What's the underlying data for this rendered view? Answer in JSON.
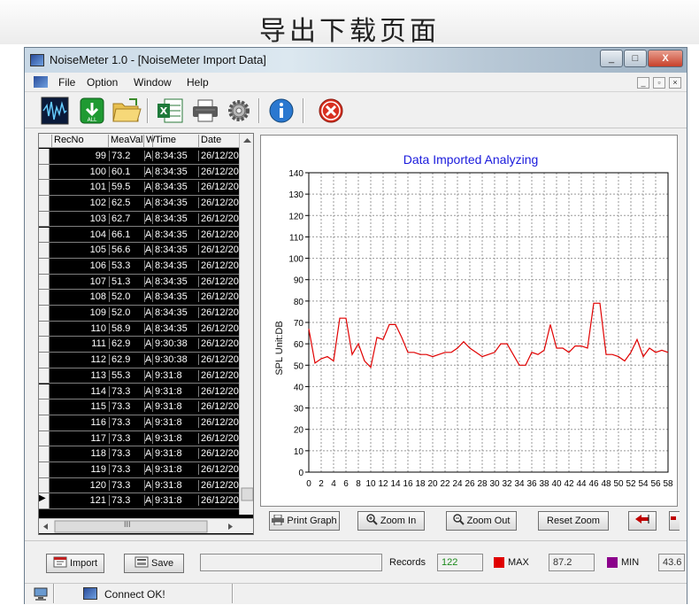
{
  "page": {
    "title": "导出下载页面"
  },
  "window": {
    "caption": "NoiseMeter 1.0  - [NoiseMeter Import Data]",
    "buttons": {
      "minimize": "_",
      "maximize": "□",
      "close": "X"
    }
  },
  "menu": {
    "items": [
      "File",
      "Option",
      "Window",
      "Help"
    ],
    "mdi_buttons": [
      "_",
      "▫",
      "×"
    ]
  },
  "toolbar": {
    "icons": [
      "waveform-icon",
      "download-all-icon",
      "open-folder-icon",
      "excel-icon",
      "printer-icon",
      "gear-icon",
      "info-icon",
      "close-icon"
    ]
  },
  "table": {
    "headers": [
      "RecNo",
      "MeaVal",
      "W",
      "Time",
      "Date"
    ],
    "rows": [
      [
        "99",
        "73.2",
        "A",
        "8:34:35",
        "26/12/20"
      ],
      [
        "100",
        "60.1",
        "A",
        "8:34:35",
        "26/12/20"
      ],
      [
        "101",
        "59.5",
        "A",
        "8:34:35",
        "26/12/20"
      ],
      [
        "102",
        "62.5",
        "A",
        "8:34:35",
        "26/12/20"
      ],
      [
        "103",
        "62.7",
        "A",
        "8:34:35",
        "26/12/20"
      ],
      [
        "104",
        "66.1",
        "A",
        "8:34:35",
        "26/12/20"
      ],
      [
        "105",
        "56.6",
        "A",
        "8:34:35",
        "26/12/20"
      ],
      [
        "106",
        "53.3",
        "A",
        "8:34:35",
        "26/12/20"
      ],
      [
        "107",
        "51.3",
        "A",
        "8:34:35",
        "26/12/20"
      ],
      [
        "108",
        "52.0",
        "A",
        "8:34:35",
        "26/12/20"
      ],
      [
        "109",
        "52.0",
        "A",
        "8:34:35",
        "26/12/20"
      ],
      [
        "110",
        "58.9",
        "A",
        "8:34:35",
        "26/12/20"
      ],
      [
        "111",
        "62.9",
        "A",
        "9:30:38",
        "26/12/20"
      ],
      [
        "112",
        "62.9",
        "A",
        "9:30:38",
        "26/12/20"
      ],
      [
        "113",
        "55.3",
        "A",
        "9:31:8",
        "26/12/20"
      ],
      [
        "114",
        "73.3",
        "A",
        "9:31:8",
        "26/12/20"
      ],
      [
        "115",
        "73.3",
        "A",
        "9:31:8",
        "26/12/20"
      ],
      [
        "116",
        "73.3",
        "A",
        "9:31:8",
        "26/12/20"
      ],
      [
        "117",
        "73.3",
        "A",
        "9:31:8",
        "26/12/20"
      ],
      [
        "118",
        "73.3",
        "A",
        "9:31:8",
        "26/12/20"
      ],
      [
        "119",
        "73.3",
        "A",
        "9:31:8",
        "26/12/20"
      ],
      [
        "120",
        "73.3",
        "A",
        "9:31:8",
        "26/12/20"
      ],
      [
        "121",
        "73.3",
        "A",
        "9:31:8",
        "26/12/20"
      ]
    ],
    "current_row_marker": "▶",
    "hscroll_thumb": "III"
  },
  "chart_buttons": {
    "print_graph": "Print Graph",
    "zoom_in": "Zoom In",
    "zoom_out": "Zoom Out",
    "reset_zoom": "Reset Zoom"
  },
  "bottom": {
    "import_label": "Import",
    "save_label": "Save",
    "records_label": "Records",
    "records_value": "122",
    "max_label": "MAX",
    "max_value": "87.2",
    "min_label": "MIN",
    "min_value": "43.6",
    "max_color": "#e00000",
    "min_color": "#8b008b"
  },
  "status": {
    "text": "Connect OK!"
  },
  "chart_data": {
    "type": "line",
    "title": "Data Imported  Analyzing",
    "xlabel": "",
    "ylabel": "SPL  Unit:DB",
    "xlim": [
      0,
      58
    ],
    "ylim": [
      0,
      140
    ],
    "x_ticks": [
      0,
      2,
      4,
      6,
      8,
      10,
      12,
      14,
      16,
      18,
      20,
      22,
      24,
      26,
      28,
      30,
      32,
      34,
      36,
      38,
      40,
      42,
      44,
      46,
      48,
      50,
      52,
      54,
      56,
      58
    ],
    "y_ticks": [
      0,
      10,
      20,
      30,
      40,
      50,
      60,
      70,
      80,
      90,
      100,
      110,
      120,
      130,
      140
    ],
    "grid": true,
    "line_color": "#e00000",
    "title_color": "#1a1adc",
    "series": [
      {
        "x": [
          0,
          1,
          2,
          3,
          4,
          5,
          6,
          7,
          8,
          9,
          10,
          11,
          12,
          13,
          14,
          15,
          16,
          17,
          18,
          19,
          20,
          21,
          22,
          23,
          24,
          25,
          26,
          27,
          28,
          29,
          30,
          31,
          32,
          33,
          34,
          35,
          36,
          37,
          38,
          39,
          40,
          41,
          42,
          43,
          44,
          45,
          46,
          47,
          48,
          49,
          50,
          51,
          52,
          53,
          54,
          55,
          56,
          57,
          58
        ],
        "values": [
          67,
          51,
          53,
          54,
          52,
          72,
          72,
          55,
          60,
          52,
          49,
          63,
          62,
          69,
          69,
          63,
          56,
          56,
          55,
          55,
          54,
          55,
          56,
          56,
          58,
          61,
          58,
          56,
          54,
          55,
          56,
          60,
          60,
          55,
          50,
          50,
          56,
          55,
          57,
          69,
          58,
          58,
          56,
          59,
          59,
          58,
          79,
          79,
          55,
          55,
          54,
          52,
          56,
          62,
          54,
          58,
          56,
          57,
          56
        ]
      }
    ]
  }
}
